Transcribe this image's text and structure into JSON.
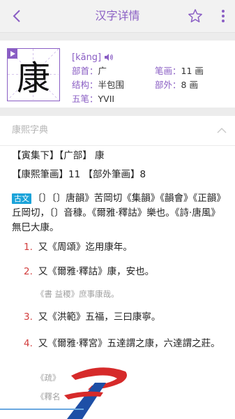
{
  "header": {
    "title": "汉字详情",
    "back_icon": "chevron-left-icon",
    "favorite_icon": "star-outline-icon",
    "more_icon": "vertical-dots-icon"
  },
  "character": {
    "glyph": "康",
    "pinyin": "[kāng]",
    "radical_label": "部首：",
    "radical_value": "广",
    "strokes_label": "笔画：",
    "strokes_value": "11 画",
    "structure_label": "结构：",
    "structure_value": "半包围",
    "extra_strokes_label": "部外：",
    "extra_strokes_value": "8 画",
    "wubi_label": "五笔：",
    "wubi_value": "YVII"
  },
  "kangxi": {
    "section_title": "康熙字典",
    "line1": "【寅集下】【广部】 康",
    "line2": "【康熙筆画】11 【部外筆画】8",
    "ancient_tag": "古文",
    "ancient_text": "〔〕〔〕唐韻》苦岡切《集韻》《韻會》《正韻》丘岡切，〔〕音穅。《爾雅·釋詁》樂也。《詩·唐風》無巳大康。",
    "definitions": [
      {
        "num": "1.",
        "text": "又《周頌》迄用康年。"
      },
      {
        "num": "2.",
        "text": "又《爾雅·釋詁》康，安也。"
      },
      {
        "num": "3.",
        "text": "又《洪範》五福，三曰康寧。"
      },
      {
        "num": "4.",
        "text": "又《爾雅·釋宮》五達謂之康，六達謂之莊。"
      }
    ],
    "quote_2": "《書 益稷》庶事康哉。",
    "quote_4a": "《疏》",
    "quote_4b": "《釋名"
  },
  "colors": {
    "accent": "#8a5ec4",
    "number_red": "#d23d3d",
    "tag_blue": "#1aa3d9"
  }
}
